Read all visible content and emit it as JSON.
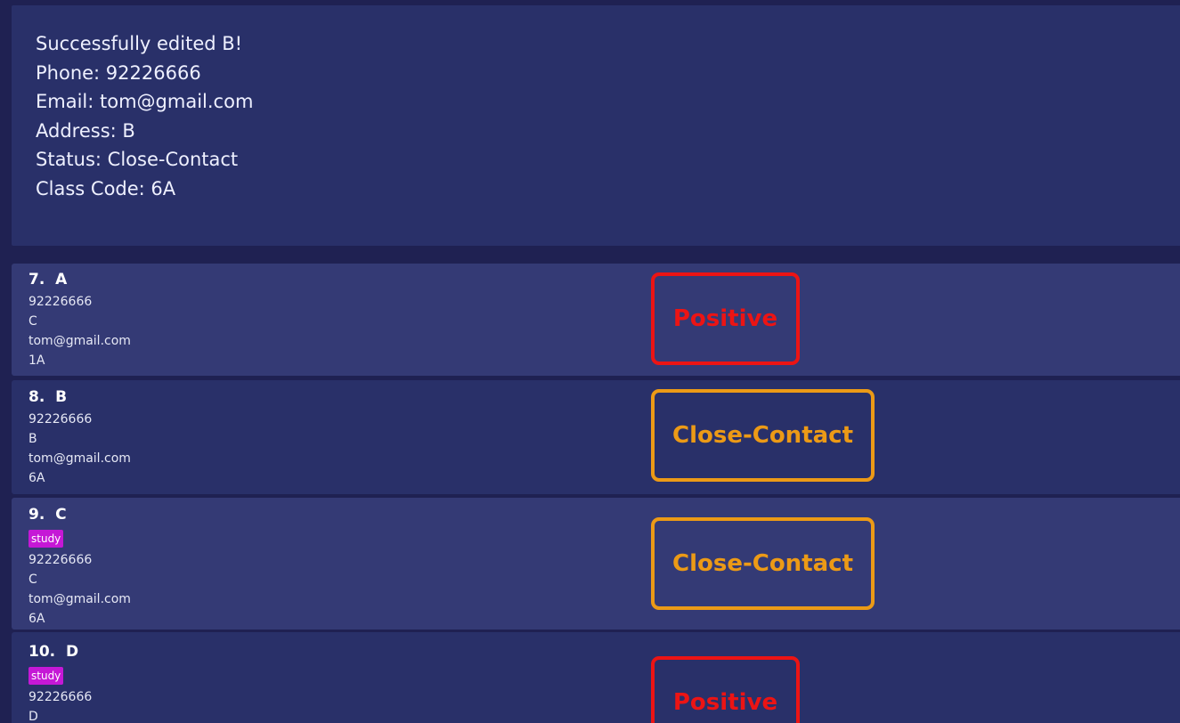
{
  "result": {
    "lines": [
      "Successfully edited B!",
      "Phone: 92226666",
      "Email: tom@gmail.com",
      "Address: B",
      "Status: Close-Contact",
      "Class Code: 6A"
    ]
  },
  "persons": [
    {
      "index": "7.",
      "name": "A",
      "tags": [],
      "phone": "92226666",
      "address": "C",
      "email": "tom@gmail.com",
      "class_code": "1A",
      "status": "Positive"
    },
    {
      "index": "8.",
      "name": "B",
      "tags": [],
      "phone": "92226666",
      "address": "B",
      "email": "tom@gmail.com",
      "class_code": "6A",
      "status": "Close-Contact"
    },
    {
      "index": "9.",
      "name": "C",
      "tags": [
        "study"
      ],
      "phone": "92226666",
      "address": "C",
      "email": "tom@gmail.com",
      "class_code": "6A",
      "status": "Close-Contact"
    },
    {
      "index": "10.",
      "name": "D",
      "tags": [
        "study"
      ],
      "phone": "92226666",
      "address": "D",
      "email": "",
      "class_code": "",
      "status": "Positive"
    }
  ],
  "colors": {
    "background": "#1f2152",
    "panel": "#293069",
    "card_alt": "#343a75",
    "tag": "#c518d6",
    "positive": "#ec1414",
    "close_contact": "#ec9a16"
  }
}
